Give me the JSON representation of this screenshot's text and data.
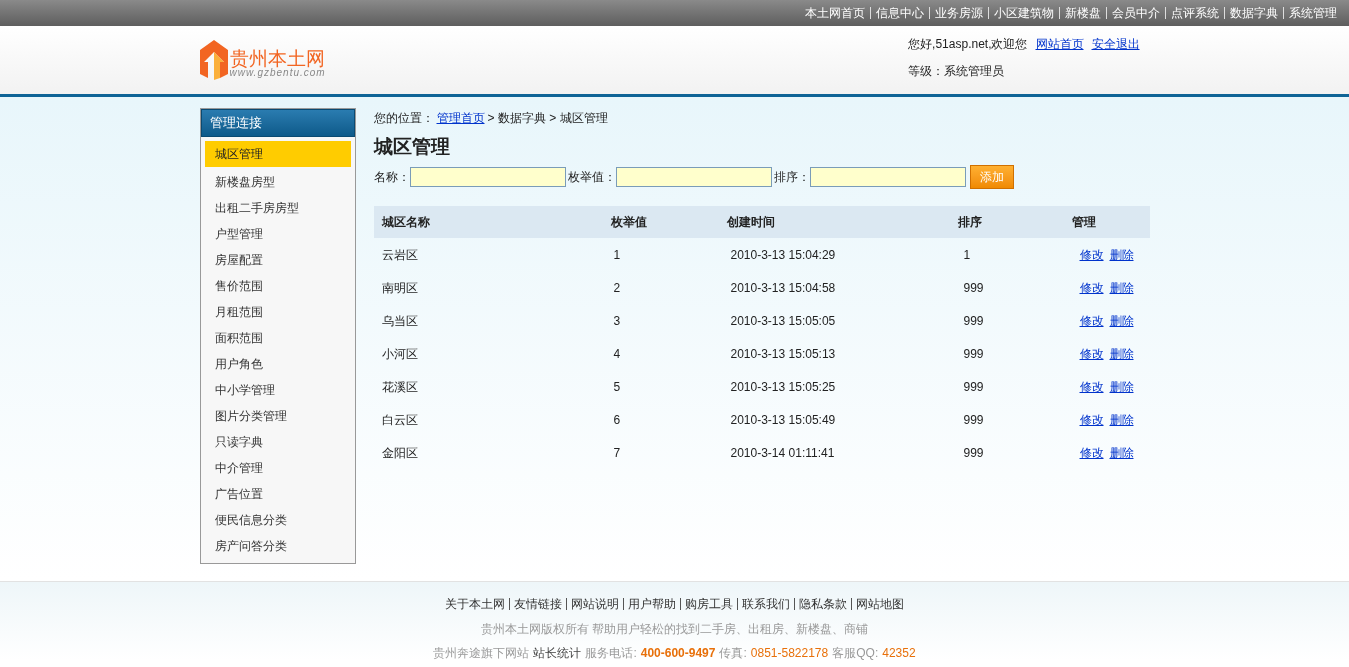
{
  "top_menu": [
    "本土网首页",
    "信息中心",
    "业务房源",
    "小区建筑物",
    "新楼盘",
    "会员中介",
    "点评系统",
    "数据字典",
    "系统管理"
  ],
  "logo": {
    "name": "贵州本土网",
    "url": "www.gzbentu.com"
  },
  "user": {
    "greeting": "您好,51asp.net,欢迎您",
    "links": [
      "网站首页",
      "安全退出"
    ],
    "level": "等级：系统管理员"
  },
  "sidebar": {
    "title": "管理连接",
    "items": [
      {
        "label": "城区管理",
        "selected": true
      },
      {
        "label": "新楼盘房型",
        "selected": false
      },
      {
        "label": "出租二手房房型",
        "selected": false
      },
      {
        "label": "户型管理",
        "selected": false
      },
      {
        "label": "房屋配置",
        "selected": false
      },
      {
        "label": "售价范围",
        "selected": false
      },
      {
        "label": "月租范围",
        "selected": false
      },
      {
        "label": "面积范围",
        "selected": false
      },
      {
        "label": "用户角色",
        "selected": false
      },
      {
        "label": "中小学管理",
        "selected": false
      },
      {
        "label": "图片分类管理",
        "selected": false
      },
      {
        "label": "只读字典",
        "selected": false
      },
      {
        "label": "中介管理",
        "selected": false
      },
      {
        "label": "广告位置",
        "selected": false
      },
      {
        "label": "便民信息分类",
        "selected": false
      },
      {
        "label": "房产问答分类",
        "selected": false
      }
    ]
  },
  "breadcrumb": {
    "prefix": "您的位置：",
    "link": "管理首页",
    "rest": "> 数据字典 > 城区管理"
  },
  "page_title": "城区管理",
  "form": {
    "fields": [
      "名称：",
      "枚举值：",
      "排序："
    ],
    "button": "添加"
  },
  "table": {
    "columns": [
      "城区名称",
      "枚举值",
      "创建时间",
      "排序",
      "管理"
    ],
    "rows": [
      {
        "cells": [
          "云岩区",
          "1",
          "2010-3-13 15:04:29",
          "1"
        ],
        "actions": [
          "修改",
          "删除"
        ]
      },
      {
        "cells": [
          "南明区",
          "2",
          "2010-3-13 15:04:58",
          "999"
        ],
        "actions": [
          "修改",
          "删除"
        ]
      },
      {
        "cells": [
          "乌当区",
          "3",
          "2010-3-13 15:05:05",
          "999"
        ],
        "actions": [
          "修改",
          "删除"
        ]
      },
      {
        "cells": [
          "小河区",
          "4",
          "2010-3-13 15:05:13",
          "999"
        ],
        "actions": [
          "修改",
          "删除"
        ]
      },
      {
        "cells": [
          "花溪区",
          "5",
          "2010-3-13 15:05:25",
          "999"
        ],
        "actions": [
          "修改",
          "删除"
        ]
      },
      {
        "cells": [
          "白云区",
          "6",
          "2010-3-13 15:05:49",
          "999"
        ],
        "actions": [
          "修改",
          "删除"
        ]
      },
      {
        "cells": [
          "金阳区",
          "7",
          "2010-3-14 01:11:41",
          "999"
        ],
        "actions": [
          "修改",
          "删除"
        ]
      }
    ]
  },
  "footer": {
    "links": [
      "关于本土网",
      "友情链接",
      "网站说明",
      "用户帮助",
      "购房工具",
      "联系我们",
      "隐私条款",
      "网站地图"
    ],
    "copyright": "贵州本土网版权所有 帮助用户轻松的找到二手房、出租房、新楼盘、商铺",
    "contact": [
      {
        "text": "贵州奔途旗下网站",
        "kind": "plain"
      },
      {
        "text": "站长统计",
        "kind": "strong"
      },
      {
        "text": "服务电话:",
        "kind": "plain"
      },
      {
        "text": "400-600-9497",
        "kind": "highlight"
      },
      {
        "text": "传真:",
        "kind": "plain"
      },
      {
        "text": "0851-5822178",
        "kind": "value"
      },
      {
        "text": "客服QQ:",
        "kind": "plain"
      },
      {
        "text": "42352",
        "kind": "value"
      }
    ]
  }
}
